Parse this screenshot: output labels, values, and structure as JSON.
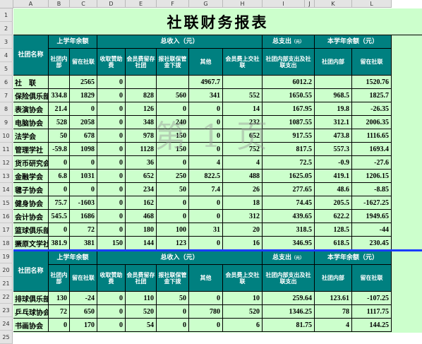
{
  "col_letters": [
    "A",
    "B",
    "C",
    "D",
    "E",
    "F",
    "G",
    "H",
    "I",
    "J",
    "K",
    "L"
  ],
  "row_numbers": [
    "1",
    "2",
    "3",
    "4",
    "5",
    "6",
    "7",
    "8",
    "9",
    "10",
    "11",
    "12",
    "13",
    "14",
    "15",
    "16",
    "17",
    "18",
    "19",
    "20",
    "21",
    "22",
    "23",
    "24",
    "25"
  ],
  "title": "社联财务报表",
  "watermark": "第 1 页",
  "header": {
    "club_name": "社团名称",
    "last_year_balance": "上学年余额",
    "total_income": "总收入（元）",
    "total_expense": "总支出",
    "total_expense_unit": "（元）",
    "this_year_balance": "本学年余额（元）",
    "in_club": "社团内部",
    "in_union": "留在社联",
    "sponsor_income": "收取赞助费",
    "fee_kept": "会员费留存社团",
    "union_grant": "报社联保管金下拨",
    "other": "其他",
    "fee_to_union": "会员费上交社联",
    "club_and_union_expense": "社团内部支出及社联支出",
    "in_club_2": "社团内部",
    "in_union_2": "留在社联"
  },
  "rows": [
    {
      "name": "社　联",
      "b": "",
      "c": "2565",
      "d": "0",
      "e": "",
      "f": "",
      "g": "4967.7",
      "h": "",
      "i": "6012.2",
      "k": "",
      "l": "1520.76"
    },
    {
      "name": "保险俱乐部",
      "b": "334.8",
      "c": "1829",
      "d": "0",
      "e": "828",
      "f": "560",
      "g": "341",
      "h": "552",
      "i": "1650.55",
      "k": "968.5",
      "l": "1825.7"
    },
    {
      "name": "表演协会",
      "b": "21.4",
      "c": "0",
      "d": "0",
      "e": "126",
      "f": "0",
      "g": "0",
      "h": "14",
      "i": "167.95",
      "k": "19.8",
      "l": "-26.35"
    },
    {
      "name": "电脑协会",
      "b": "528",
      "c": "2058",
      "d": "0",
      "e": "348",
      "f": "240",
      "g": "0",
      "h": "232",
      "i": "1087.55",
      "k": "312.1",
      "l": "2006.35"
    },
    {
      "name": "法学会",
      "b": "50",
      "c": "678",
      "d": "0",
      "e": "978",
      "f": "150",
      "g": "0",
      "h": "652",
      "i": "917.55",
      "k": "473.8",
      "l": "1116.65"
    },
    {
      "name": "管理学社",
      "b": "-59.8",
      "c": "1098",
      "d": "0",
      "e": "1128",
      "f": "150",
      "g": "0",
      "h": "752",
      "i": "817.5",
      "k": "557.3",
      "l": "1693.4"
    },
    {
      "name": "货币研究会",
      "b": "0",
      "c": "0",
      "d": "0",
      "e": "36",
      "f": "0",
      "g": "4",
      "h": "4",
      "i": "72.5",
      "k": "-0.9",
      "l": "-27.6"
    },
    {
      "name": "金融学会",
      "b": "6.8",
      "c": "1031",
      "d": "0",
      "e": "652",
      "f": "250",
      "g": "822.5",
      "h": "488",
      "i": "1625.05",
      "k": "419.1",
      "l": "1206.15"
    },
    {
      "name": "毽子协会",
      "b": "0",
      "c": "0",
      "d": "0",
      "e": "234",
      "f": "50",
      "g": "7.4",
      "h": "26",
      "i": "277.65",
      "k": "48.6",
      "l": "-8.85"
    },
    {
      "name": "健身协会",
      "b": "75.7",
      "c": "-1603",
      "d": "0",
      "e": "162",
      "f": "0",
      "g": "0",
      "h": "18",
      "i": "74.45",
      "k": "205.5",
      "l": "-1627.25"
    },
    {
      "name": "会计协会",
      "b": "545.5",
      "c": "1686",
      "d": "0",
      "e": "468",
      "f": "0",
      "g": "0",
      "h": "312",
      "i": "439.65",
      "k": "622.2",
      "l": "1949.65"
    },
    {
      "name": "篮球俱乐部",
      "b": "0",
      "c": "72",
      "d": "0",
      "e": "180",
      "f": "100",
      "g": "31",
      "h": "20",
      "i": "318.5",
      "k": "128.5",
      "l": "-44"
    },
    {
      "name": "撅原文学社",
      "b": "381.9",
      "c": "381",
      "d": "150",
      "e": "144",
      "f": "123",
      "g": "0",
      "h": "16",
      "i": "346.95",
      "k": "618.5",
      "l": "230.45"
    }
  ],
  "rows2": [
    {
      "name": "排球俱乐部",
      "b": "130",
      "c": "-24",
      "d": "0",
      "e": "110",
      "f": "50",
      "g": "0",
      "h": "10",
      "i": "259.64",
      "k": "123.61",
      "l": "-107.25"
    },
    {
      "name": "乒乓球协会",
      "b": "72",
      "c": "650",
      "d": "0",
      "e": "520",
      "f": "0",
      "g": "780",
      "h": "520",
      "i": "1346.25",
      "k": "78",
      "l": "1117.75"
    },
    {
      "name": "书画协会",
      "b": "0",
      "c": "170",
      "d": "0",
      "e": "54",
      "f": "0",
      "g": "0",
      "h": "6",
      "i": "81.75",
      "k": "4",
      "l": "144.25"
    }
  ]
}
